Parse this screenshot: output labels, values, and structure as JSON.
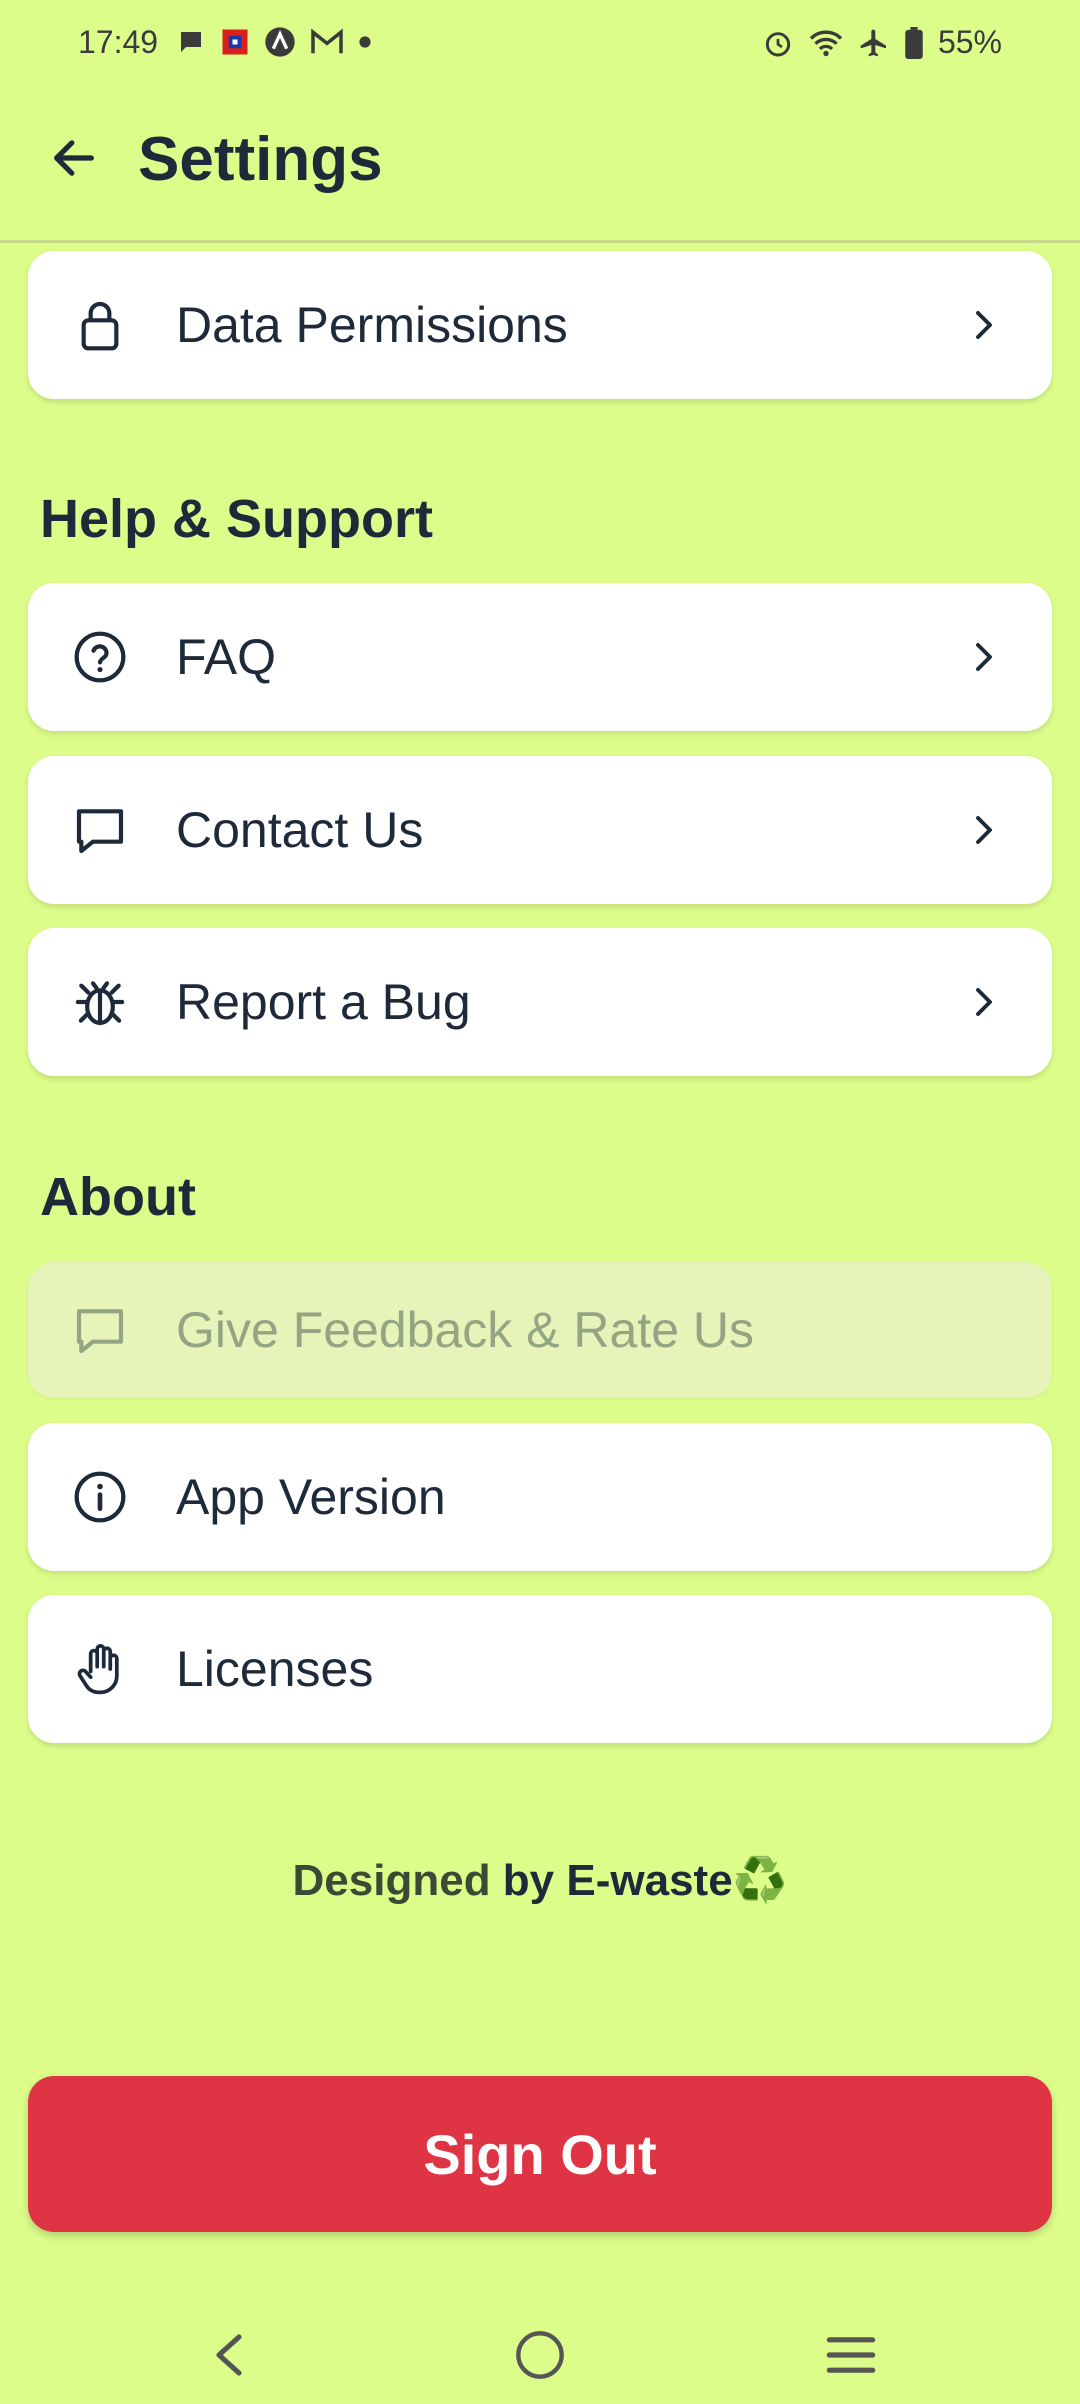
{
  "colors": {
    "background": "#dcfd8a",
    "danger": "#de3444",
    "text": "#1e2a3a"
  },
  "status_bar": {
    "time": "17:49",
    "battery": "55%",
    "left_icons": [
      "chat-bubble-icon",
      "notification-app-icon",
      "arc-app-icon",
      "gmail-icon",
      "dot-icon"
    ],
    "right_icons": [
      "alarm-icon",
      "wifi-icon",
      "airplane-icon",
      "battery-icon"
    ]
  },
  "header": {
    "title": "Settings",
    "back_icon": "back-arrow-icon"
  },
  "sections": {
    "privacy": {
      "items": [
        {
          "label": "Data Permissions",
          "icon": "lock-icon"
        }
      ]
    },
    "help": {
      "title": "Help & Support",
      "items": [
        {
          "label": "FAQ",
          "icon": "question-circle-icon"
        },
        {
          "label": "Contact Us",
          "icon": "message-icon"
        },
        {
          "label": "Report a Bug",
          "icon": "bug-icon"
        }
      ]
    },
    "about": {
      "title": "About",
      "items": [
        {
          "label": "Give Feedback & Rate Us",
          "icon": "message-icon",
          "disabled": true
        },
        {
          "label": "App Version",
          "icon": "info-circle-icon"
        },
        {
          "label": "Licenses",
          "icon": "hand-icon"
        }
      ]
    }
  },
  "footer": {
    "designed_prefix": "Designed",
    "designed_suffix": " by E-waste",
    "emoji": "♻️"
  },
  "sign_out": {
    "label": "Sign Out"
  },
  "nav_bar": {
    "back": "nav-back-icon",
    "home": "nav-home-icon",
    "recents": "nav-recents-icon"
  }
}
